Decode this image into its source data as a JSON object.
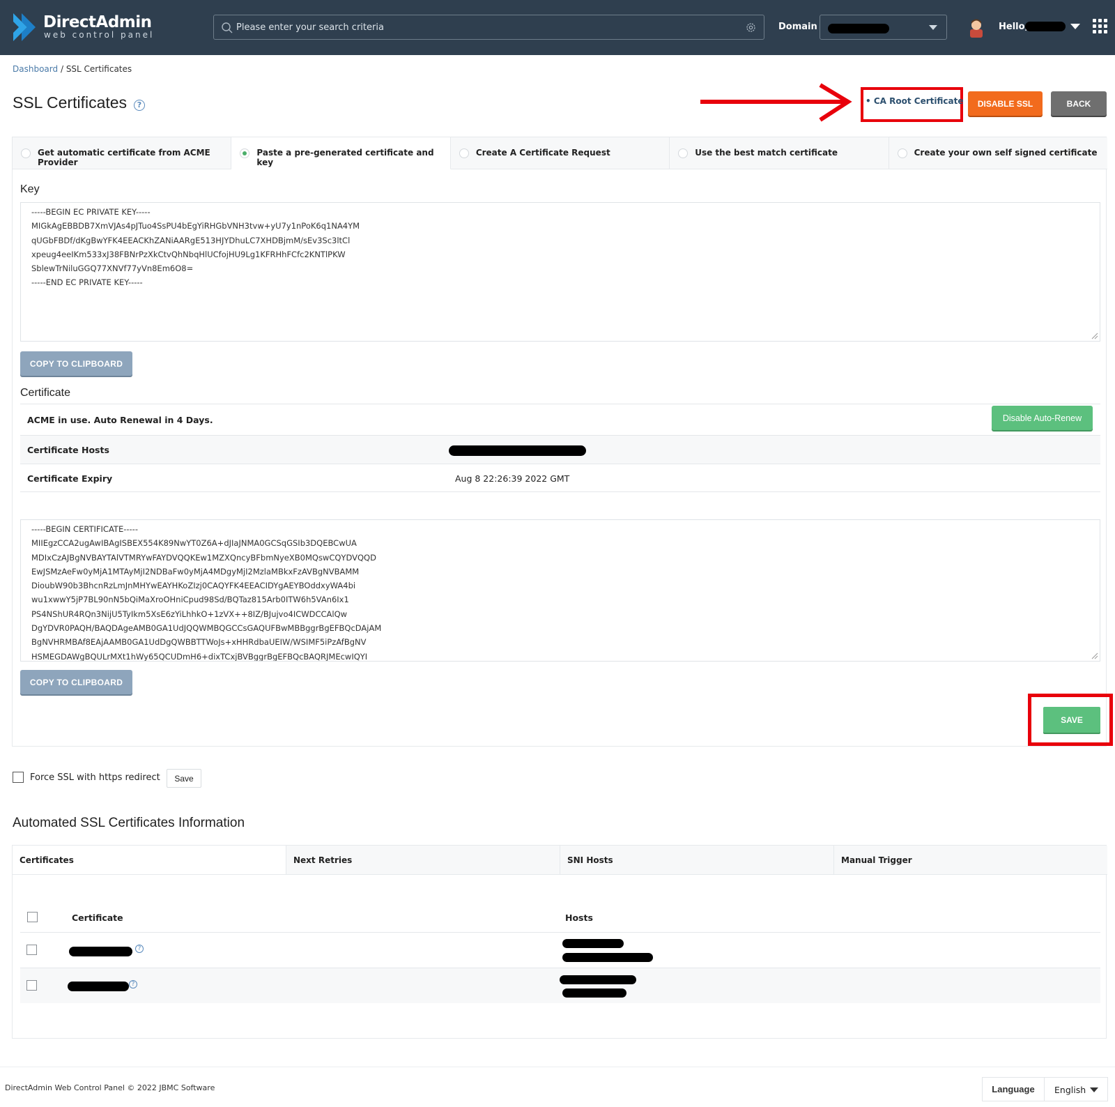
{
  "header": {
    "logo_title": "DirectAdmin",
    "logo_subtitle": "web control panel",
    "search_placeholder": "Please enter your search criteria",
    "domain_label": "Domain",
    "hello_label": "Hello,"
  },
  "breadcrumb": {
    "home": "Dashboard",
    "separator": "/",
    "current": "SSL Certificates"
  },
  "page": {
    "title": "SSL Certificates",
    "help": "?",
    "ca_root_link": "• CA Root Certificate",
    "disable_ssl": "DISABLE SSL",
    "back": "BACK"
  },
  "tabs": [
    {
      "label": "Get automatic certificate from ACME Provider",
      "selected": false
    },
    {
      "label": "Paste a pre-generated certificate and key",
      "selected": true
    },
    {
      "label": "Create A Certificate Request",
      "selected": false
    },
    {
      "label": "Use the best match certificate",
      "selected": false
    },
    {
      "label": "Create your own self signed certificate",
      "selected": false
    }
  ],
  "key_section": {
    "label": "Key",
    "lines": [
      "-----BEGIN EC PRIVATE KEY-----",
      "MIGkAgEBBDB7XmVJAs4pJTuo4SsPU4bEgYiRHGbVNH3tvw+yU7y1nPoK6q1NA4YM",
      "qUGbFBDf/dKgBwYFK4EEACKhZANiAARgE513HJYDhuLC7XHDBjmM/sEv3Sc3ltCl",
      "xpeug4eeIKm533xJ38FBNrPzXkCtvQhNbqHlUCfojHU9Lg1KFRHhFCfc2KNTlPKW",
      "SblewTrNiluGGQ77XNVf77yVn8Em6O8=",
      "-----END EC PRIVATE KEY-----"
    ],
    "copy_button": "COPY TO CLIPBOARD"
  },
  "certificate_section": {
    "label": "Certificate",
    "acme_status": "ACME in use. Auto Renewal in 4 Days.",
    "disable_autorenew": "Disable Auto-Renew",
    "hosts_label": "Certificate Hosts",
    "expiry_label": "Certificate Expiry",
    "expiry_value": "Aug 8 22:26:39 2022 GMT",
    "lines": [
      "-----BEGIN CERTIFICATE-----",
      "MIIEgzCCA2ugAwIBAgISBEX554K89NwYT0Z6A+dJIaJNMA0GCSqGSIb3DQEBCwUA",
      "MDIxCzAJBgNVBAYTAlVTMRYwFAYDVQQKEw1MZXQncyBFbmNyeXB0MQswCQYDVQQD",
      "EwJSMzAeFw0yMjA1MTAyMjI2NDBaFw0yMjA4MDgyMjI2MzlaMBkxFzAVBgNVBAMM",
      "DioubW90b3BhcnRzLmJnMHYwEAYHKoZIzj0CAQYFK4EEACIDYgAEYBOddxyWA4bi",
      "wu1xwwY5jP7BL90nN5bQiMaXroOHniCpud98Sd/BQTaz815Arb0ITW6h5VAn6Ix1",
      "PS4NShUR4RQn3NijU5TyIkm5XsE6zYiLhhkO+1zVX++8IZ/BJujvo4ICWDCCAlQw",
      "DgYDVR0PAQH/BAQDAgeAMB0GA1UdJQQWMBQGCCsGAQUFBwMBBggrBgEFBQcDAjAM",
      "BgNVHRMBAf8EAjAAMB0GA1UdDgQWBBTTWoJs+xHHRdbaUEIW/WSIMF5iPzAfBgNV",
      "HSMEGDAWgBQULrMXt1hWy65QCUDmH6+dixTCxjBVBggrBgEFBQcBAQRJMEcwIQYI"
    ],
    "copy_button": "COPY TO CLIPBOARD",
    "save_button": "SAVE"
  },
  "force_ssl": {
    "label": "Force SSL with https redirect",
    "save": "Save"
  },
  "automated": {
    "title": "Automated SSL Certificates Information",
    "columns": [
      "Certificates",
      "Next Retries",
      "SNI Hosts",
      "Manual Trigger"
    ],
    "table_headers": {
      "certificate": "Certificate",
      "hosts": "Hosts"
    },
    "help": "?"
  },
  "footer": {
    "copyright": "DirectAdmin Web Control Panel © 2022 JBMC Software",
    "language_label": "Language",
    "language_value": "English"
  },
  "colors": {
    "header_bg": "#2f3f4f",
    "accent_orange": "#f26b1d",
    "accent_green": "#5cc07e",
    "annotation_red": "#e8000b",
    "copy_button": "#8ea5bc"
  },
  "icons": [
    "directadmin-logo-icon",
    "search-icon",
    "gear-icon",
    "chevron-down-icon",
    "avatar-icon",
    "apps-grid-icon",
    "help-icon"
  ]
}
